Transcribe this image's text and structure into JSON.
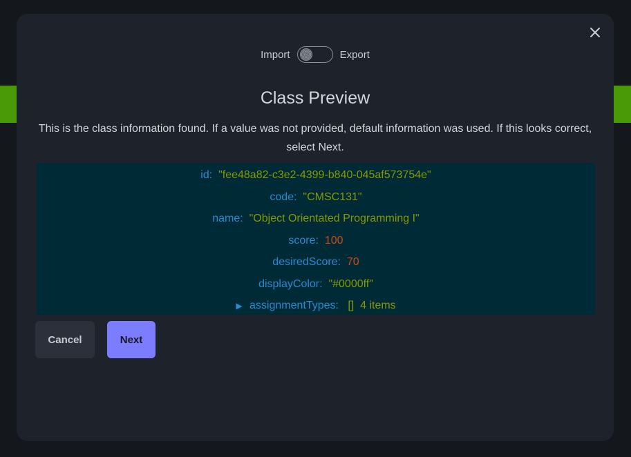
{
  "toggle": {
    "left_label": "Import",
    "right_label": "Export"
  },
  "modal": {
    "title": "Class Preview",
    "description": "This is the class information found. If a value was not provided, default information was used. If this looks correct, select Next."
  },
  "json_preview": {
    "id_key": "id:",
    "id_value": "\"fee48a82-c3e2-4399-b840-045af573754e\"",
    "code_key": "code:",
    "code_value": "\"CMSC131\"",
    "name_key": "name:",
    "name_value": "\"Object Orientated Programming I\"",
    "score_key": "score:",
    "score_value": "100",
    "desired_key": "desiredScore:",
    "desired_value": "70",
    "color_key": "displayColor:",
    "color_value": "\"#0000ff\"",
    "types_key": "assignmentTypes:",
    "types_bracket": "[]",
    "types_count": "4 items"
  },
  "buttons": {
    "cancel": "Cancel",
    "next": "Next"
  },
  "colors": {
    "accent": "#7c7cff",
    "green_strip": "#4a9a08",
    "json_bg": "#002b36",
    "json_key": "#268bd2",
    "json_string": "#859900",
    "json_number": "#cb4b16"
  }
}
